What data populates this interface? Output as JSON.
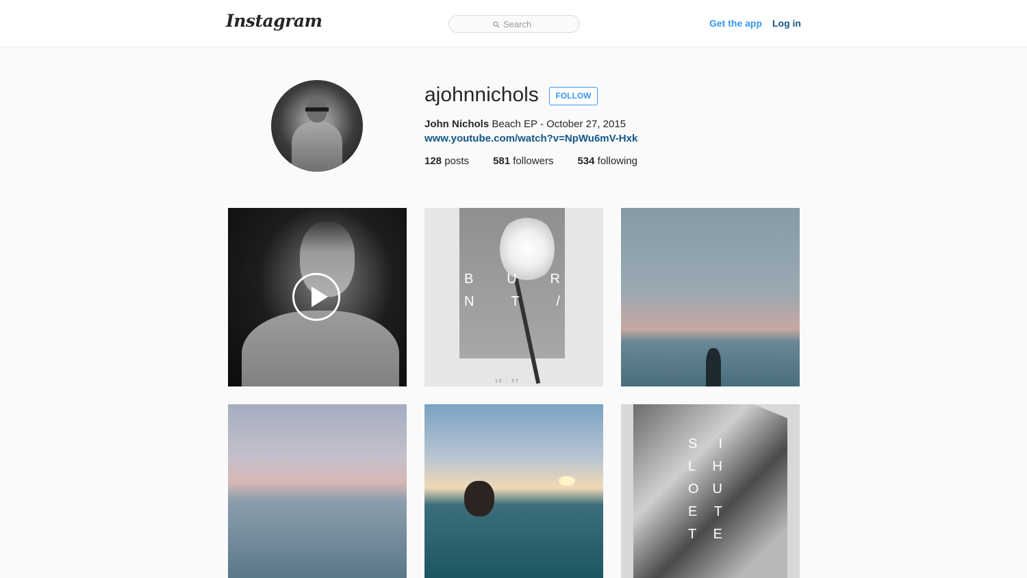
{
  "header": {
    "logo": "Instagram",
    "search_placeholder": "Search",
    "get_app": "Get the app",
    "login": "Log in"
  },
  "profile": {
    "username": "ajohnnichols",
    "follow_label": "FOLLOW",
    "full_name": "John Nichols",
    "bio_text": " Beach EP - October 27, 2015 ",
    "bio_link": "www.youtube.com/watch?v=NpWu6mV-Hxk",
    "stats": [
      {
        "count": "128",
        "label": " posts"
      },
      {
        "count": "581",
        "label": " followers"
      },
      {
        "count": "534",
        "label": " following"
      }
    ]
  },
  "posts": [
    {
      "type": "video",
      "icon": "play-icon"
    },
    {
      "type": "image",
      "letters": [
        [
          "B",
          "U",
          "R"
        ],
        [
          "N",
          "T",
          "/"
        ]
      ],
      "caption": "10 · 27"
    },
    {
      "type": "image"
    },
    {
      "type": "image"
    },
    {
      "type": "image"
    },
    {
      "type": "image",
      "letters": [
        [
          "S",
          "I"
        ],
        [
          "L",
          "H"
        ],
        [
          "O",
          "U"
        ],
        [
          "E",
          "T"
        ],
        [
          "T",
          "E"
        ]
      ]
    }
  ],
  "colors": {
    "accent": "#3897f0",
    "link": "#125688",
    "text": "#262626",
    "background": "#fafafa"
  }
}
